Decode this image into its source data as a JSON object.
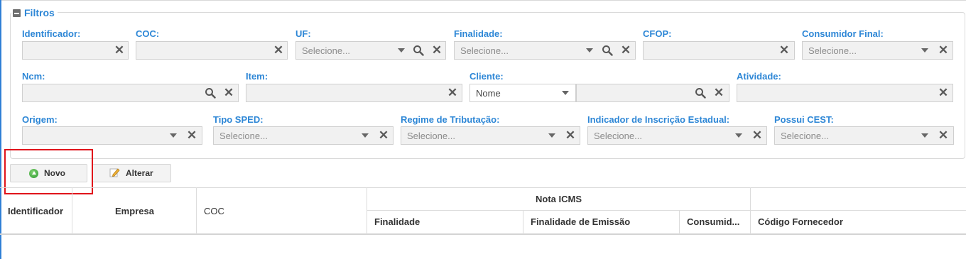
{
  "filters": {
    "title": "Filtros",
    "fields": {
      "identificador": {
        "label": "Identificador:"
      },
      "coc": {
        "label": "COC:"
      },
      "uf": {
        "label": "UF:",
        "placeholder": "Selecione..."
      },
      "finalidade": {
        "label": "Finalidade:",
        "placeholder": "Selecione..."
      },
      "cfop": {
        "label": "CFOP:"
      },
      "consumidor_final": {
        "label": "Consumidor Final:",
        "placeholder": "Selecione..."
      },
      "ncm": {
        "label": "Ncm:"
      },
      "item": {
        "label": "Item:"
      },
      "cliente": {
        "label": "Cliente:",
        "type_value": "Nome"
      },
      "atividade": {
        "label": "Atividade:"
      },
      "origem": {
        "label": "Origem:"
      },
      "tipo_sped": {
        "label": "Tipo SPED:",
        "placeholder": "Selecione..."
      },
      "regime_tributacao": {
        "label": "Regime de Tributação:",
        "placeholder": "Selecione..."
      },
      "indicador_ie": {
        "label": "Indicador de Inscrição Estadual:",
        "placeholder": "Selecione..."
      },
      "possui_cest": {
        "label": "Possui CEST:",
        "placeholder": "Selecione..."
      }
    }
  },
  "toolbar": {
    "novo_label": "Novo",
    "alterar_label": "Alterar"
  },
  "grid": {
    "columns": {
      "identificador": "Identificador",
      "empresa": "Empresa",
      "coc": "COC",
      "nota_icms_group": "Nota ICMS",
      "finalidade": "Finalidade",
      "finalidade_emissao": "Finalidade de Emissão",
      "consumidor": "Consumid...",
      "codigo_fornecedor": "Código Fornecedor"
    }
  },
  "colors": {
    "accent_blue": "#2e87d6",
    "highlight_red": "#e0141b",
    "field_bg": "#f1f1f1"
  }
}
